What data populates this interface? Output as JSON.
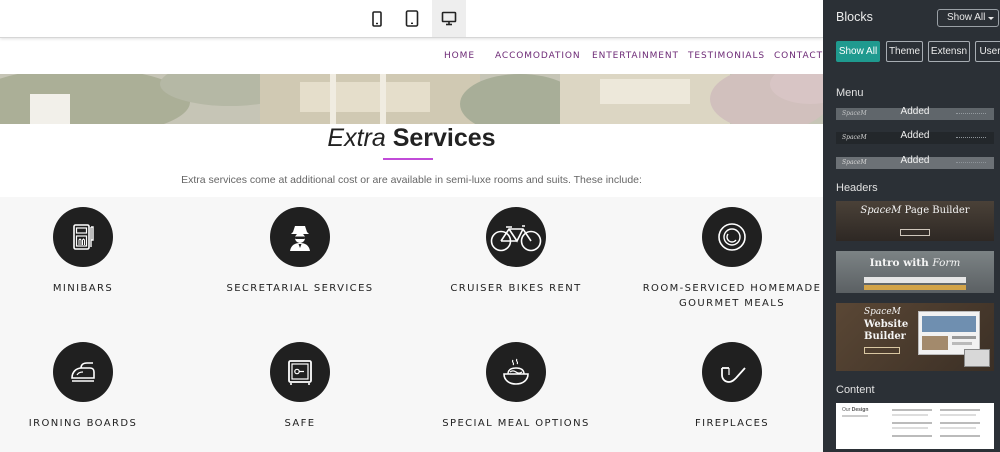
{
  "device_bar": {
    "devices": [
      "phone-view",
      "tablet-view",
      "desktop-view"
    ],
    "active": "desktop-view"
  },
  "nav": {
    "items": [
      "HOME",
      "ACCOMODATION",
      "ENTERTAINMENT",
      "TESTIMONIALS",
      "CONTACTS"
    ]
  },
  "services": {
    "title_italic": "Extra",
    "title_bold": "Services",
    "subtitle": "Extra services come at additional cost or are available in semi-luxe rooms and suits. These include:",
    "items": [
      {
        "label": "MINIBARS",
        "icon": "minibar-icon"
      },
      {
        "label": "SECRETARIAL SERVICES",
        "icon": "agent-icon"
      },
      {
        "label": "CRUISER BIKES RENT",
        "icon": "bicycle-icon"
      },
      {
        "label": "ROOM-SERVICED HOMEMADE GOURMET MEALS",
        "icon": "plate-icon"
      },
      {
        "label": "IRONING BOARDS",
        "icon": "iron-icon"
      },
      {
        "label": "SAFE",
        "icon": "safe-icon"
      },
      {
        "label": "SPECIAL MEAL OPTIONS",
        "icon": "noodles-icon"
      },
      {
        "label": "FIREPLACES",
        "icon": "pipe-icon"
      }
    ]
  },
  "panel": {
    "title": "Blocks",
    "dropdown": "Show All",
    "filters": [
      "Show All",
      "Theme",
      "Extensn",
      "User"
    ],
    "active_filter": "Show All",
    "sections": {
      "menu": "Menu",
      "headers": "Headers",
      "content": "Content"
    },
    "menu_thumbs": [
      {
        "logo": "SpaceM",
        "status": "Added"
      },
      {
        "logo": "SpaceM",
        "status": "Added"
      },
      {
        "logo": "SpaceM",
        "status": "Added"
      }
    ],
    "header_thumbs": [
      {
        "brand": "SpaceM",
        "title": "Page Builder"
      },
      {
        "title": "Intro with",
        "title_italic": "Form"
      },
      {
        "brand": "SpaceM",
        "line1": "Website",
        "line2": "Builder"
      }
    ],
    "content_thumb": {
      "title_a": "Our",
      "title_b": "Design"
    }
  },
  "colors": {
    "nav_text": "#6d2a76",
    "accent_underline": "#c14bd8",
    "panel_bg": "#2b3036",
    "filter_active": "#1f9a8f",
    "icon_circle": "#202020"
  }
}
